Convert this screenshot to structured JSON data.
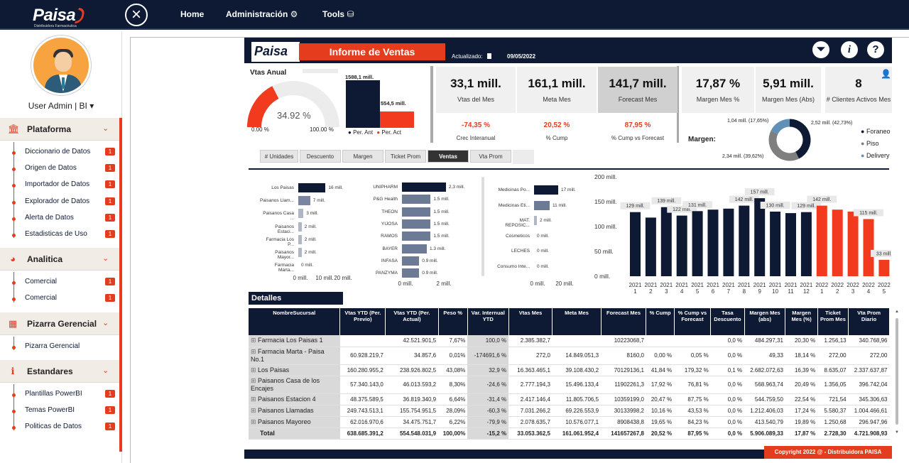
{
  "nav": {
    "brand": "Paisa",
    "brand_sub": "Distribuidora Farmacéutica",
    "links": [
      "Home",
      "Administración ⚙",
      "Tools ⛁"
    ]
  },
  "sidebar": {
    "user": "User Admin | BI ▾",
    "sections": [
      {
        "label": "Plataforma",
        "icon": "bank-icon",
        "items": [
          {
            "label": "Diccionario de Datos",
            "badge": "1"
          },
          {
            "label": "Origen de Datos",
            "badge": "1"
          },
          {
            "label": "Importador de Datos",
            "badge": "1"
          },
          {
            "label": "Explorador de Datos",
            "badge": "1"
          },
          {
            "label": "Alerta de Datos",
            "badge": "1"
          },
          {
            "label": "Estadisticas de Uso",
            "badge": "1"
          }
        ]
      },
      {
        "label": "Analitica",
        "icon": "pie-chart-icon",
        "items": [
          {
            "label": "Comercial",
            "badge": "1"
          },
          {
            "label": "Comercial",
            "badge": "1"
          }
        ]
      },
      {
        "label": "Pizarra Gerencial",
        "icon": "dashboard-icon",
        "items": [
          {
            "label": "Pizarra Gerencial",
            "badge": ""
          }
        ]
      },
      {
        "label": "Estandares",
        "icon": "info-icon",
        "items": [
          {
            "label": "Plantillas PowerBI",
            "badge": "1"
          },
          {
            "label": "Temas PowerBI",
            "badge": "1"
          },
          {
            "label": "Politicas de Datos",
            "badge": "1"
          }
        ]
      }
    ]
  },
  "report": {
    "logo": "Paisa",
    "title": "Informe de Ventas",
    "updated_label": "Actualizado:",
    "updated_date": "09/05/2022",
    "gauge": {
      "title": "Vtas Anual",
      "value": "34.92 %",
      "min": "0.00 %",
      "max": "100.00 %",
      "fraction": 0.3492
    },
    "compare": {
      "prev_label": "1588,1 mill.",
      "act_label": "554,5 mill.",
      "prev": 1588.1,
      "act": 554.5,
      "legend_prev": "Per. Ant",
      "legend_act": "Per. Act"
    },
    "cards": [
      {
        "value": "33,1 mill.",
        "label": "Vtas del Mes"
      },
      {
        "value": "161,1 mill.",
        "label": "Meta Mes"
      },
      {
        "value": "141,7 mill.",
        "label": "Forecast Mes"
      },
      {
        "value": "17,87 %",
        "label": "Margen Mes %"
      },
      {
        "value": "5,91 mill.",
        "label": "Margen Mes (Abs)"
      },
      {
        "value": "8",
        "label": "# Clientes Activos Mes"
      }
    ],
    "subs": [
      {
        "value": "-74,35 %",
        "label": "Crec Interanual"
      },
      {
        "value": "20,52 %",
        "label": "% Cump"
      },
      {
        "value": "87,95 %",
        "label": "% Cump vs Forecast"
      }
    ],
    "margen": {
      "label": "Margen:",
      "slices": [
        {
          "name": "Foraneo",
          "label": "2,52 mill. (42,73%)",
          "value": 42.73,
          "color": "#0e1a33"
        },
        {
          "name": "Piso",
          "label": "2,34 mill. (39,62%)",
          "value": 39.62,
          "color": "#7f7f7f"
        },
        {
          "name": "Delivery",
          "label": "1,04 mill. (17,65%)",
          "value": 17.65,
          "color": "#5f90b8"
        }
      ]
    },
    "tabs": [
      "# Unidades",
      "Descuento",
      "Margen",
      "Ticket Prom",
      "Ventas",
      "Vta Prom"
    ],
    "active_tab": "Ventas"
  },
  "chart_data": [
    {
      "type": "bar",
      "orientation": "horizontal",
      "categories": [
        "Los Paisas",
        "Paisanos Llam...",
        "Paisanos Casa ...",
        "Paisanos Estaci...",
        "Farmacia Los P...",
        "Paisanos Mayor...",
        "Farmacia Marta..."
      ],
      "values": [
        16,
        7,
        3,
        2,
        2,
        2,
        0
      ],
      "value_labels": [
        "16 mill.",
        "7 mill.",
        "3 mill.",
        "2 mill.",
        "2 mill.",
        "2 mill.",
        "0 mill."
      ],
      "xticks": [
        "0 mill.",
        "10 mill.",
        "20 mill."
      ],
      "xlim": [
        0,
        20
      ]
    },
    {
      "type": "bar",
      "orientation": "horizontal",
      "categories": [
        "UNIPHARM",
        "P&G Health",
        "THEON",
        "YIJOSA",
        "RAMOS",
        "BAYER",
        "INFASA",
        "PANZYMA"
      ],
      "values": [
        2.3,
        1.5,
        1.5,
        1.5,
        1.5,
        1.3,
        0.9,
        0.9
      ],
      "value_labels": [
        "2,3 mill.",
        "1.5 mill.",
        "1.5 mill.",
        "1.5 mill.",
        "1.5 mill.",
        "1.3 mill.",
        "0.9 mill.",
        "0.9 mill."
      ],
      "xticks": [
        "0 mill.",
        "2 mill."
      ],
      "xlim": [
        0,
        2.6
      ]
    },
    {
      "type": "bar",
      "orientation": "horizontal",
      "categories": [
        "Medicinas Po...",
        "Medicinas Eti...",
        "MAT. REPOSIC...",
        "Cosmeticos",
        "LECHES",
        "Consumo Inte..."
      ],
      "values": [
        17,
        11,
        2,
        0,
        0,
        0
      ],
      "value_labels": [
        "17 mill.",
        "11 mill.",
        "2 mill.",
        "0 mill.",
        "0 mill.",
        "0 mill."
      ],
      "xticks": [
        "0 mill.",
        "20 mill."
      ],
      "xlim": [
        0,
        20
      ]
    },
    {
      "type": "bar",
      "categories": [
        "2021 1",
        "2021 2",
        "2021 3",
        "2021 4",
        "2021 5",
        "2021 6",
        "2021 7",
        "2021 8",
        "2021 9",
        "2021 10",
        "2021 11",
        "2021 12",
        "2022 1",
        "2022 2",
        "2022 3",
        "2022 4",
        "2022 5"
      ],
      "values": [
        129,
        118,
        139,
        122,
        131,
        134,
        136,
        142,
        157,
        130,
        127,
        129,
        142,
        134,
        130,
        115,
        33
      ],
      "labels": [
        "129 mill.",
        "",
        "139 mill.",
        "122 mill.",
        "131 mill.",
        "",
        "",
        "142 mill.",
        "157 mill.",
        "130 mill.",
        "",
        "129 mill.",
        "142 mill.",
        "",
        "",
        "115 mill.",
        "33 mill."
      ],
      "colors_by_year": {
        "2021": "#0e1a33",
        "2022": "#f23a1e"
      },
      "yticks": [
        "0 mill.",
        "50 mill.",
        "100 mill.",
        "150 mill.",
        "200 mill."
      ],
      "ylim": [
        0,
        200
      ]
    }
  ],
  "table": {
    "title": "Detalles",
    "headers": [
      "NombreSucursal",
      "Vtas YTD (Per. Previo)",
      "Vtas YTD (Per. Actual)",
      "Peso %",
      "Var. Internual YTD",
      "Vtas Mes",
      "Meta Mes",
      "Forecast Mes",
      "% Cump",
      "% Cump vs Forecast",
      "Tasa Descuento",
      "Margen Mes (abs)",
      "Margen Mes (%)",
      "Ticket Prom Mes",
      "Vta Prom Diario"
    ],
    "rows": [
      [
        "Farmacia Los Paisas 1",
        "",
        "42.521.901,5",
        "7,67%",
        "100,0 %",
        "2.385.382,7",
        "",
        "10223068,7",
        "",
        "",
        "0,0 %",
        "484.297,31",
        "20,30 %",
        "1.256,13",
        "340.768,96"
      ],
      [
        "Farmacia Marta - Paisa No.1",
        "60.928.219,7",
        "34.857,6",
        "0,01%",
        "-174691,6 %",
        "272,0",
        "14.849.051,3",
        "8160,0",
        "0,00 %",
        "0,05 %",
        "0,0 %",
        "49,33",
        "18,14 %",
        "272,00",
        "272,00"
      ],
      [
        "Los Paisas",
        "160.280.955,2",
        "238.926.802,5",
        "43,08%",
        "32,9 %",
        "16.363.465,1",
        "39.108.430,2",
        "70129136,1",
        "41,84 %",
        "179,32 %",
        "0,1 %",
        "2.682.072,63",
        "16,39 %",
        "8.635,07",
        "2.337.637,87"
      ],
      [
        "Paisanos Casa de los Encajes",
        "57.340.143,0",
        "46.013.593,2",
        "8,30%",
        "-24,6 %",
        "2.777.194,3",
        "15.496.133,4",
        "11902261,3",
        "17,92 %",
        "76,81 %",
        "0,0 %",
        "568.963,74",
        "20,49 %",
        "1.356,05",
        "396.742,04"
      ],
      [
        "Paisanos Estacion 4",
        "48.375.589,5",
        "36.819.340,9",
        "6,64%",
        "-31,4 %",
        "2.417.146,4",
        "11.805.706,5",
        "10359199,0",
        "20,47 %",
        "87,75 %",
        "0,0 %",
        "544.759,50",
        "22,54 %",
        "721,54",
        "345.306,63"
      ],
      [
        "Paisanos Llamadas",
        "249.743.513,1",
        "155.754.951,5",
        "28,09%",
        "-60,3 %",
        "7.031.266,2",
        "69.226.553,9",
        "30133998,2",
        "10,16 %",
        "43,53 %",
        "0,0 %",
        "1.212.406,03",
        "17,24 %",
        "5.580,37",
        "1.004.466,61"
      ],
      [
        "Paisanos Mayoreo",
        "62.016.970,6",
        "34.475.751,7",
        "6,22%",
        "-79,9 %",
        "2.078.635,7",
        "10.576.077,1",
        "8908438,8",
        "19,65 %",
        "84,23 %",
        "0,0 %",
        "413.540,79",
        "19,89 %",
        "1.250,68",
        "296.947,96"
      ]
    ],
    "total": [
      "Total",
      "638.685.391,2",
      "554.548.031,9",
      "100,00%",
      "-15,2 %",
      "33.053.362,5",
      "161.061.952,4",
      "141657267,8",
      "20,52 %",
      "87,95 %",
      "0,0 %",
      "5.906.089,33",
      "17,87 %",
      "2.728,30",
      "4.721.908,93"
    ]
  },
  "footer": {
    "copyright": "Copyright 2022 @ - Distribuidora PAISA"
  }
}
